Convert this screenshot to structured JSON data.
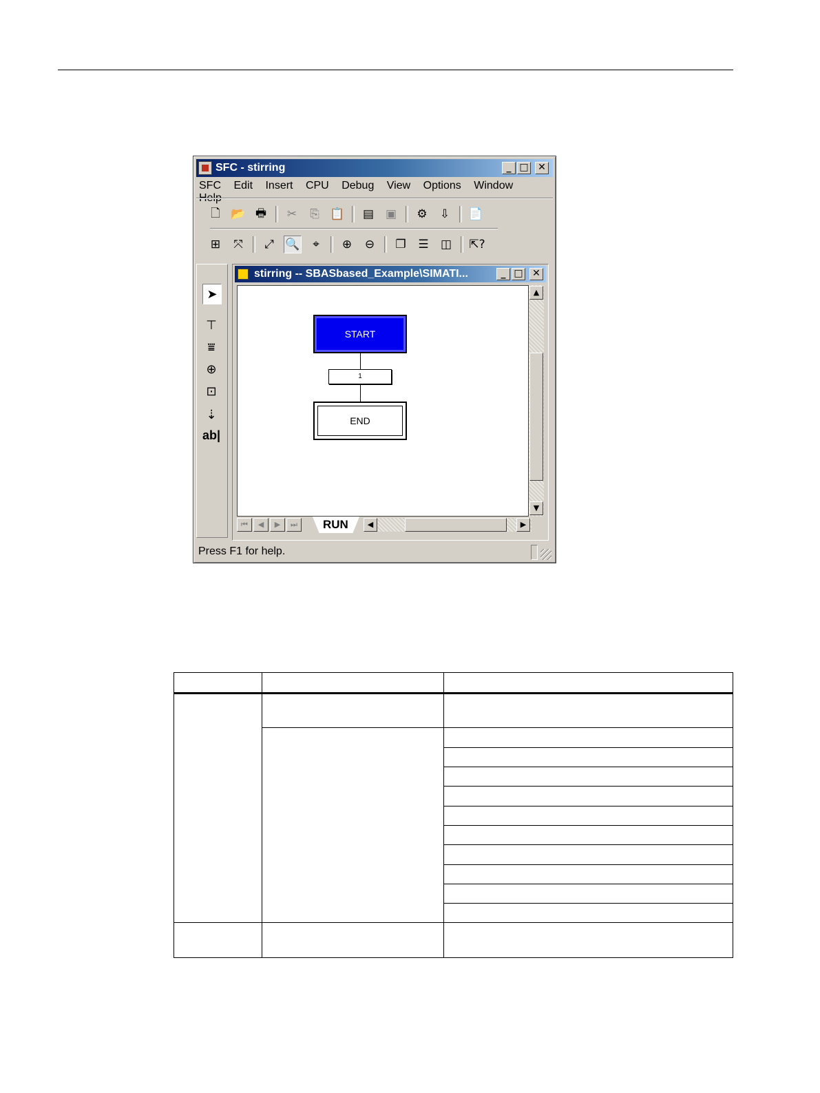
{
  "window": {
    "title": "SFC - stirring",
    "controls": {
      "minimize": "_",
      "maximize": "□",
      "close": "✕"
    }
  },
  "menubar": {
    "items": [
      "SFC",
      "Edit",
      "Insert",
      "CPU",
      "Debug",
      "View",
      "Options",
      "Window",
      "Help"
    ]
  },
  "toolbar": {
    "row1_icons": [
      "new-icon",
      "open-icon",
      "print-icon",
      "cut-icon",
      "copy-icon",
      "paste-icon",
      "properties-icon",
      "object-properties-icon",
      "compile-icon",
      "download-icon",
      "documentation-icon"
    ],
    "row2_icons": [
      "overview-icon",
      "layout-icon",
      "zoom-fit-icon",
      "zoom-area-icon",
      "zoom-point-icon",
      "zoom-in-icon",
      "zoom-out-icon",
      "cascade-icon",
      "tile-horizontal-icon",
      "tile-vertical-icon",
      "context-help-icon"
    ]
  },
  "palette": {
    "icons": [
      "select-arrow-icon",
      "step-transition-icon",
      "simultaneous-branch-icon",
      "alternative-branch-icon",
      "loop-icon",
      "jump-icon",
      "text-field-icon"
    ],
    "text_tool_label": "ab|"
  },
  "child_window": {
    "title": "stirring -- SBASbased_Example\\SIMATI...",
    "controls": {
      "minimize": "_",
      "maximize": "□",
      "close": "✕"
    }
  },
  "sfc": {
    "start_step": "START",
    "transition": "1",
    "end_step": "END"
  },
  "sheet_tab": {
    "label": "RUN"
  },
  "statusbar": {
    "message": "Press F1 for help."
  },
  "colors": {
    "start_step": "#0000f0",
    "titlebar_start": "#0a246a",
    "titlebar_end": "#a6caf0"
  }
}
